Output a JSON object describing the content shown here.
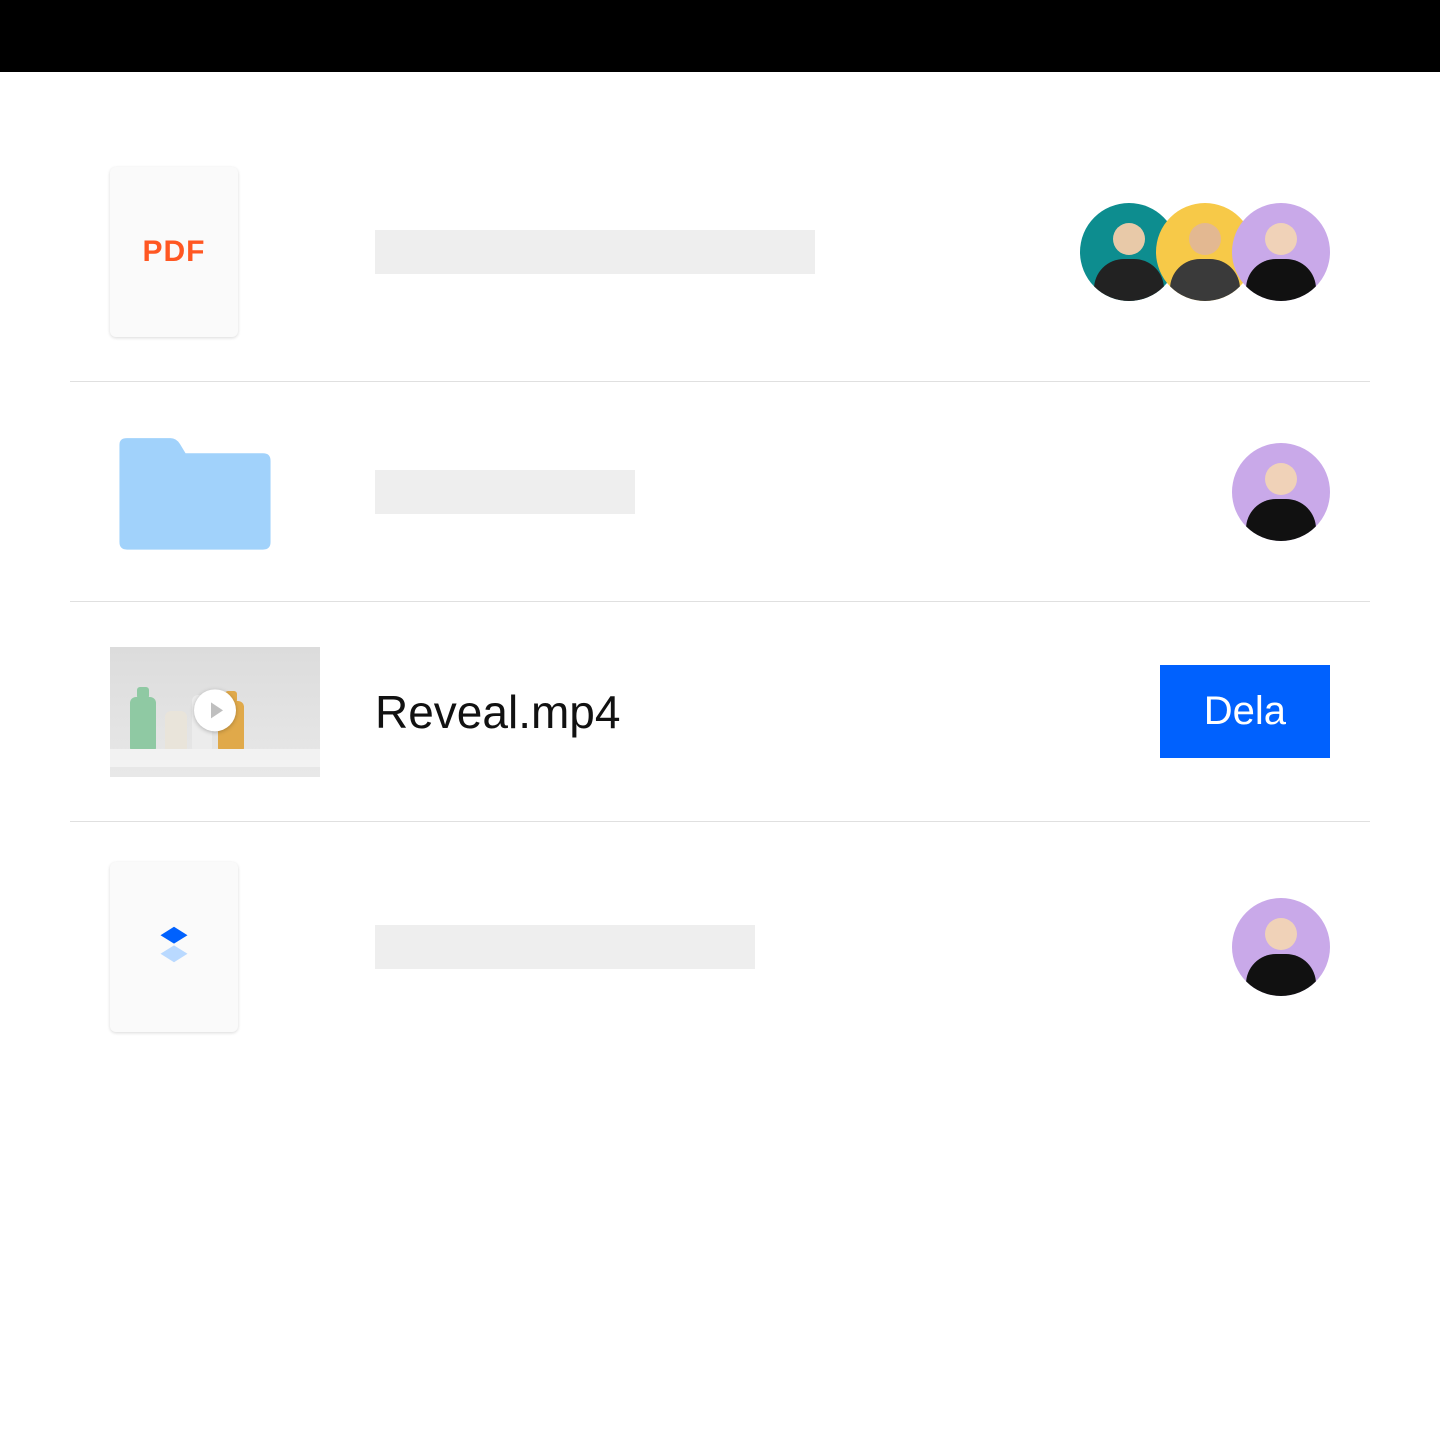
{
  "colors": {
    "accent": "#0061fe",
    "pdf_label": "#ff5722",
    "folder": "#a1d2fb",
    "avatar_teal": "#0d8d8f",
    "avatar_yellow": "#f7c948",
    "avatar_purple": "#c9a9e9"
  },
  "rows": [
    {
      "type": "pdf",
      "icon_label": "PDF",
      "name": "",
      "collaborators": [
        {
          "color": "teal"
        },
        {
          "color": "yellow"
        },
        {
          "color": "purple"
        }
      ]
    },
    {
      "type": "folder",
      "name": "",
      "collaborators": [
        {
          "color": "purple"
        }
      ]
    },
    {
      "type": "video",
      "name": "Reveal.mp4",
      "action_label": "Dela"
    },
    {
      "type": "dropbox",
      "name": "",
      "collaborators": [
        {
          "color": "purple"
        }
      ]
    }
  ]
}
